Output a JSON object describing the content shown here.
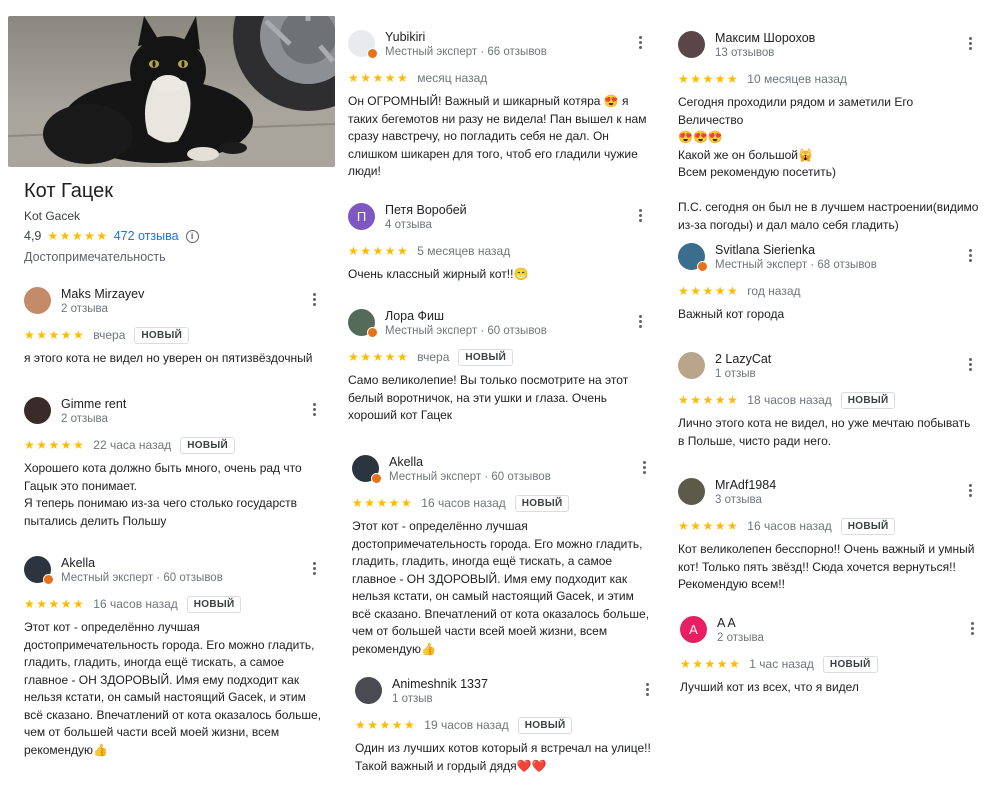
{
  "place": {
    "title": "Кот Гацек",
    "subtitle": "Kot Gacek",
    "rating": "4,9",
    "stars": "★★★★★",
    "reviews_count": "472 отзыва",
    "category": "Достопримечательность"
  },
  "reviews": [
    {
      "name": "Maks Mirzayev",
      "meta": "2 отзыва",
      "stars": "★★★★★",
      "date": "вчера",
      "badge": "НОВЫЙ",
      "text": "я этого кота не видел но уверен он пятизвёздочный",
      "avatar_color": "#c48b6a",
      "avatar_letter": "",
      "expert": false
    },
    {
      "name": "Gimme rent",
      "meta": "2 отзыва",
      "stars": "★★★★★",
      "date": "22 часа назад",
      "badge": "НОВЫЙ",
      "text": "Хорошего кота должно быть много, очень рад что\nГацык это понимает.\nЯ теперь понимаю из-за чего столько государств\nпытались делить Польшу",
      "avatar_color": "#3b2a2a",
      "avatar_letter": "",
      "expert": false
    },
    {
      "name": "Akella",
      "meta": "Местный эксперт · 60 отзывов",
      "stars": "★★★★★",
      "date": "16 часов назад",
      "badge": "НОВЫЙ",
      "text": "Этот кот - определённо лучшая\nдостопримечательность города. Его можно гладить,\nгладить, гладить, иногда ещё тискать, а самое\nглавное - ОН ЗДОРОВЫЙ. Имя ему подходит как\nнельзя кстати, он самый настоящий Gacek, и этим\nвсё сказано. Впечатлений от кота оказалось больше,\nчем от большей части всей моей жизни, всем\nрекомендую👍",
      "avatar_color": "#2c3440",
      "avatar_letter": "",
      "expert": true
    },
    {
      "name": "Yubikiri",
      "meta": "Местный эксперт · 66 отзывов",
      "stars": "★★★★★",
      "date": "месяц назад",
      "badge": "",
      "text": "Он ОГРОМНЫЙ! Важный и шикарный котяра 😍 я\nтаких бегемотов ни разу не видела! Пан вышел к нам\nсразу навстречу, но погладить себя не дал. Он\nслишком шикарен для того, чтоб его гладили чужие\nлюди!",
      "avatar_color": "#e8eaed",
      "avatar_letter": "",
      "expert": true
    },
    {
      "name": "Петя Воробей",
      "meta": "4 отзыва",
      "stars": "★★★★★",
      "date": "5 месяцев назад",
      "badge": "",
      "text": "Очень классный жирный кот!!😁",
      "avatar_color": "#7e57c2",
      "avatar_letter": "П",
      "expert": false
    },
    {
      "name": "Лора Фиш",
      "meta": "Местный эксперт · 60 отзывов",
      "stars": "★★★★★",
      "date": "вчера",
      "badge": "НОВЫЙ",
      "text": "Само великолепие! Вы только посмотрите на этот\nбелый воротничок, на эти ушки и глаза. Очень\nхороший кот Гацек",
      "avatar_color": "#556b5a",
      "avatar_letter": "",
      "expert": true
    },
    {
      "name": "Akella",
      "meta": "Местный эксперт · 60 отзывов",
      "stars": "★★★★★",
      "date": "16 часов назад",
      "badge": "НОВЫЙ",
      "text": "Этот кот - определённо лучшая\nдостопримечательность города. Его можно гладить,\nгладить, гладить, иногда ещё тискать, а самое\nглавное - ОН ЗДОРОВЫЙ. Имя ему подходит как\nнельзя кстати, он самый настоящий Gacek, и этим\nвсё сказано. Впечатлений от кота оказалось больше,\nчем от большей части всей моей жизни, всем\nрекомендую👍",
      "avatar_color": "#2c3440",
      "avatar_letter": "",
      "expert": true
    },
    {
      "name": "Animeshnik 1337",
      "meta": "1 отзыв",
      "stars": "★★★★★",
      "date": "19 часов назад",
      "badge": "НОВЫЙ",
      "text": "Один из лучших котов который я встречал на улице!!\nТакой важный и гордый дядя❤️❤️",
      "avatar_color": "#4a4a52",
      "avatar_letter": "",
      "expert": false
    },
    {
      "name": "Максим Шорохов",
      "meta": "13 отзывов",
      "stars": "★★★★★",
      "date": "10 месяцев назад",
      "badge": "",
      "text": "Сегодня проходили рядом и заметили Его Величество\n😍😍😍\nКакой же он большой🙀\nВсем рекомендую посетить)\n\nП.С. сегодня он был не в лучшем настроении(видимо\nиз-за погоды) и дал мало себя гладить)",
      "avatar_color": "#5a4648",
      "avatar_letter": "",
      "expert": false
    },
    {
      "name": "Svitlana Sierienka",
      "meta": "Местный эксперт · 68 отзывов",
      "stars": "★★★★★",
      "date": "год назад",
      "badge": "",
      "text": "Важный кот города",
      "avatar_color": "#3a6e8c",
      "avatar_letter": "",
      "expert": true
    },
    {
      "name": "2 LazyCat",
      "meta": "1 отзыв",
      "stars": "★★★★★",
      "date": "18 часов назад",
      "badge": "НОВЫЙ",
      "text": "Лично этого кота не видел, но уже мечтаю побывать\nв Польше, чисто ради него.",
      "avatar_color": "#b9a58c",
      "avatar_letter": "",
      "expert": false
    },
    {
      "name": "MrAdf1984",
      "meta": "3 отзыва",
      "stars": "★★★★★",
      "date": "16 часов назад",
      "badge": "НОВЫЙ",
      "text": "Кот великолепен бесспорно!! Очень важный и умный\nкот! Только пять звёзд!! Сюда хочется вернуться!!\nРекомендую всем!!",
      "avatar_color": "#5c5a48",
      "avatar_letter": "",
      "expert": false
    },
    {
      "name": "A A",
      "meta": "2 отзыва",
      "stars": "★★★★★",
      "date": "1 час назад",
      "badge": "НОВЫЙ",
      "text": "Лучший кот из всех, что я видел",
      "avatar_color": "#e91e63",
      "avatar_letter": "A",
      "expert": false
    }
  ]
}
